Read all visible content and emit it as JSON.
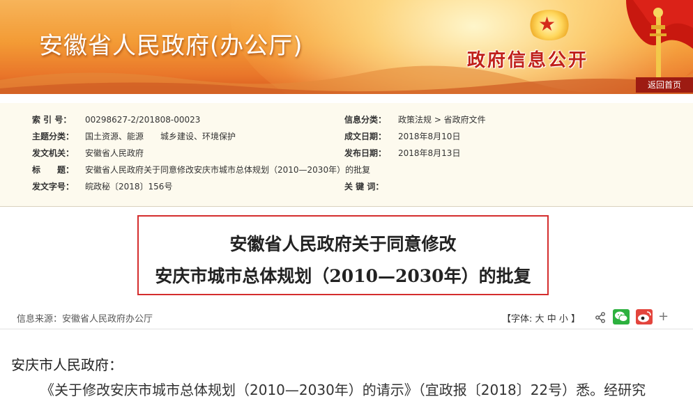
{
  "banner": {
    "title": "安徽省人民政府(办公厅)",
    "right_title": "政府信息公开",
    "home_button": "返回首页",
    "colors": {
      "banner_top": "#f7b45a",
      "banner_bottom": "#d95b1f",
      "accent_red": "#c0201a"
    }
  },
  "info": {
    "index_label": "索 引 号：",
    "index_value": "00298627-2/201808-00023",
    "category_label": "信息分类：",
    "category_value": "政策法规 > 省政府文件",
    "topic_label": "主题分类：",
    "topic_value": "国土资源、能源　　城乡建设、环境保护",
    "created_label": "成文日期：",
    "created_value": "2018年8月10日",
    "issuer_label": "发文机关：",
    "issuer_value": "安徽省人民政府",
    "published_label": "发布日期：",
    "published_value": "2018年8月13日",
    "title_label": "标　　题：",
    "title_value": "安徽省人民政府关于同意修改安庆市城市总体规划（2010—2030年）的批复",
    "docno_label": "发文字号：",
    "docno_value": "皖政秘〔2018〕156号",
    "keywords_label": "关 键 词：",
    "keywords_value": ""
  },
  "document": {
    "title_line1": "安徽省人民政府关于同意修改",
    "title_line2": "安庆市城市总体规划（2010—2030年）的批复",
    "border_color": "#d42d2d"
  },
  "source_bar": {
    "source": "信息来源：安徽省人民政府办公厅",
    "font_label": "【字体:",
    "font_large": "大",
    "font_medium": "中",
    "font_small": "小",
    "font_end": "】"
  },
  "body": {
    "salutation": "安庆市人民政府：",
    "paragraph_partial": "《关于修改安庆市城市总体规划（2010—2030年）的请示》（宜政报〔2018〕22号）悉。经研究"
  }
}
